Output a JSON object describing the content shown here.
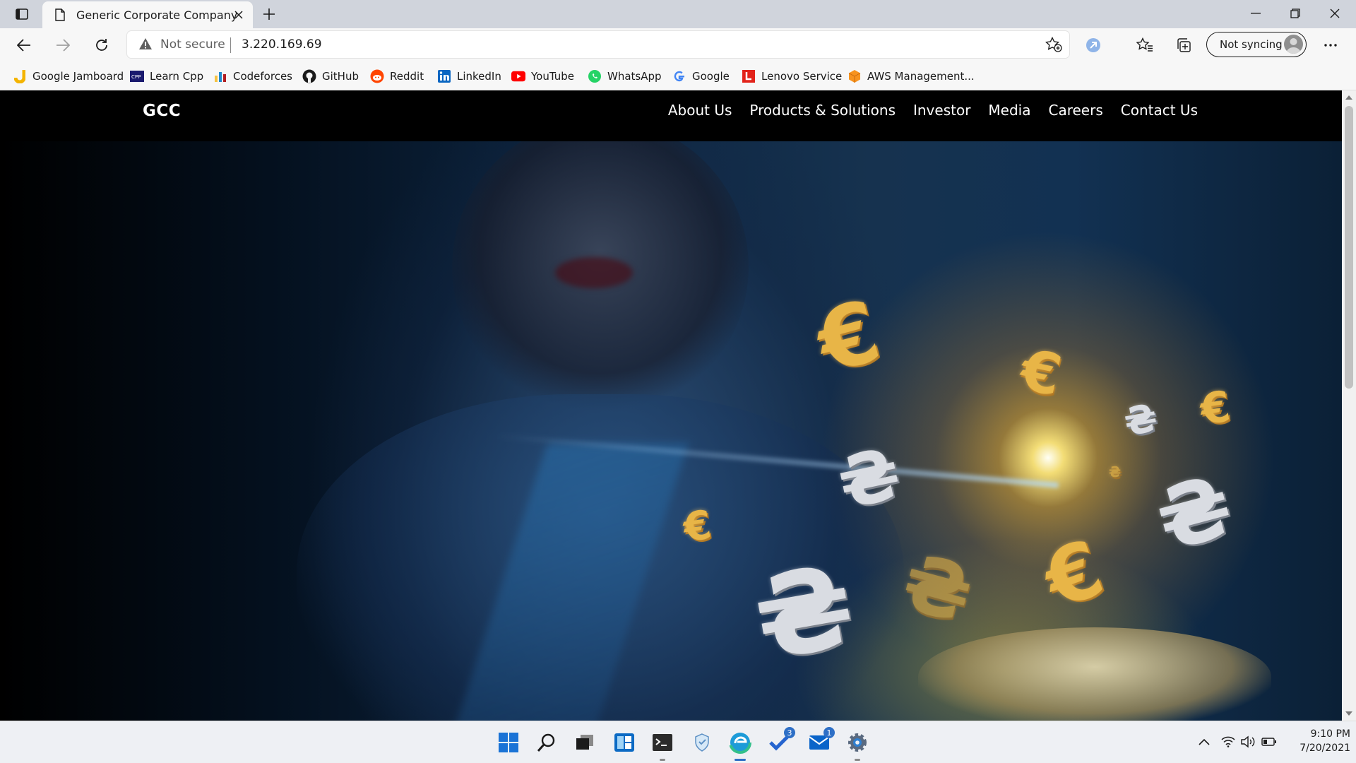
{
  "browser": {
    "tab_title": "Generic Corporate Company",
    "security_label": "Not secure",
    "url": "3.220.169.69",
    "sync_label": "Not syncing"
  },
  "bookmarks": [
    {
      "label": "Google Jamboard",
      "icon": "jamboard-icon",
      "color": "#f4b400"
    },
    {
      "label": "Learn Cpp",
      "icon": "cpp-icon",
      "color": "#1a1a6e"
    },
    {
      "label": "Codeforces",
      "icon": "codeforces-icon",
      "color": "#1f8acb"
    },
    {
      "label": "GitHub",
      "icon": "github-icon",
      "color": "#1b1b1b"
    },
    {
      "label": "Reddit",
      "icon": "reddit-icon",
      "color": "#ff4500"
    },
    {
      "label": "LinkedIn",
      "icon": "linkedin-icon",
      "color": "#0a66c2"
    },
    {
      "label": "YouTube",
      "icon": "youtube-icon",
      "color": "#ff0000"
    },
    {
      "label": "WhatsApp",
      "icon": "whatsapp-icon",
      "color": "#25d366"
    },
    {
      "label": "Google",
      "icon": "google-icon",
      "color": "#4285f4"
    },
    {
      "label": "Lenovo Service",
      "icon": "lenovo-icon",
      "color": "#e2231a"
    },
    {
      "label": "AWS Management...",
      "icon": "aws-icon",
      "color": "#f7931e"
    }
  ],
  "site": {
    "logo": "GCC",
    "nav": [
      "About Us",
      "Products & Solutions",
      "Investor",
      "Media",
      "Careers",
      "Contact Us"
    ],
    "hero_symbols": [
      "€",
      "€",
      "₴",
      "€",
      "₴",
      "₴",
      "€",
      "₴",
      "₴",
      "€",
      "₴"
    ]
  },
  "taskbar": {
    "todo_badge": "3",
    "mail_badge": "1",
    "time": "9:10 PM",
    "date": "7/20/2021"
  },
  "colors": {
    "site_header": "#000000",
    "accent": "#2e6fc6"
  }
}
